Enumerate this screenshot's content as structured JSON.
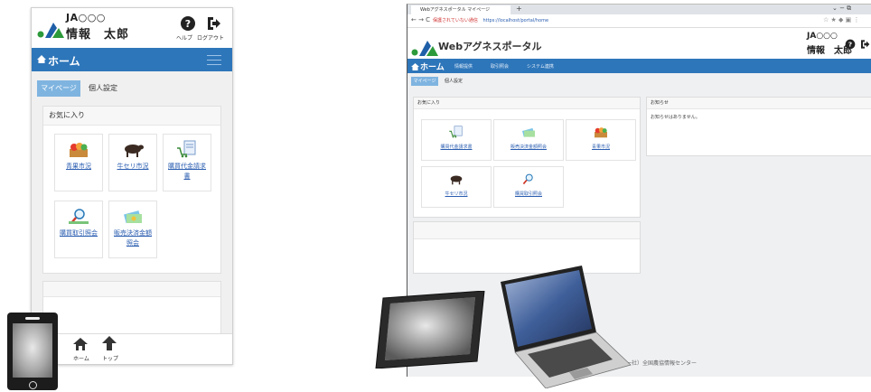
{
  "mobile": {
    "header": {
      "org": "JA○○○",
      "user": "情報　太郎",
      "help_label": "ヘルプ",
      "logout_label": "ログアウト"
    },
    "nav": {
      "title": "ホーム"
    },
    "tabs": [
      {
        "label": "マイページ"
      },
      {
        "label": "個人設定"
      }
    ],
    "favorites": {
      "title": "お気に入り",
      "tiles": [
        {
          "label": "青果市況",
          "icon": "vegetables-icon"
        },
        {
          "label": "牛セリ市況",
          "icon": "cattle-icon"
        },
        {
          "label": "購買代金請求書",
          "icon": "cart-document-icon"
        },
        {
          "label": "購買取引照会",
          "icon": "search-icon"
        },
        {
          "label": "販売決済金額照会",
          "icon": "money-icon"
        }
      ]
    },
    "footer": {
      "home_label": "ホーム",
      "top_label": "トップ"
    }
  },
  "desktop": {
    "browser": {
      "tab_title": "Webアグネスポータル マイページ",
      "url_warning": "保護されていない通信",
      "url": "https://localhost/portal/home"
    },
    "header": {
      "title": "Webアグネスポータル",
      "org": "JA○○○",
      "user": "情報　太郎"
    },
    "nav": {
      "home": "ホーム",
      "items": [
        "情報提供",
        "取引照会",
        "システム連携"
      ]
    },
    "tabs": [
      {
        "label": "マイページ"
      },
      {
        "label": "個人設定"
      }
    ],
    "favorites": {
      "title": "お気に入り",
      "tiles": [
        {
          "label": "購買代金請求書",
          "icon": "cart-document-icon"
        },
        {
          "label": "販売決済金額照会",
          "icon": "money-icon"
        },
        {
          "label": "青果市況",
          "icon": "vegetables-icon"
        },
        {
          "label": "牛セリ市況",
          "icon": "cattle-icon"
        },
        {
          "label": "購買取引照会",
          "icon": "search-icon"
        }
      ]
    },
    "notices": {
      "title": "お知らせ",
      "message": "お知らせはありません。"
    },
    "footer": "（一社）全国農協情報センター"
  },
  "colors": {
    "nav_blue": "#2e76ba",
    "tab_active": "#7fb4e0",
    "link": "#2a5db0",
    "logo_blue": "#1f5fa8",
    "logo_green": "#2c9a3a"
  }
}
